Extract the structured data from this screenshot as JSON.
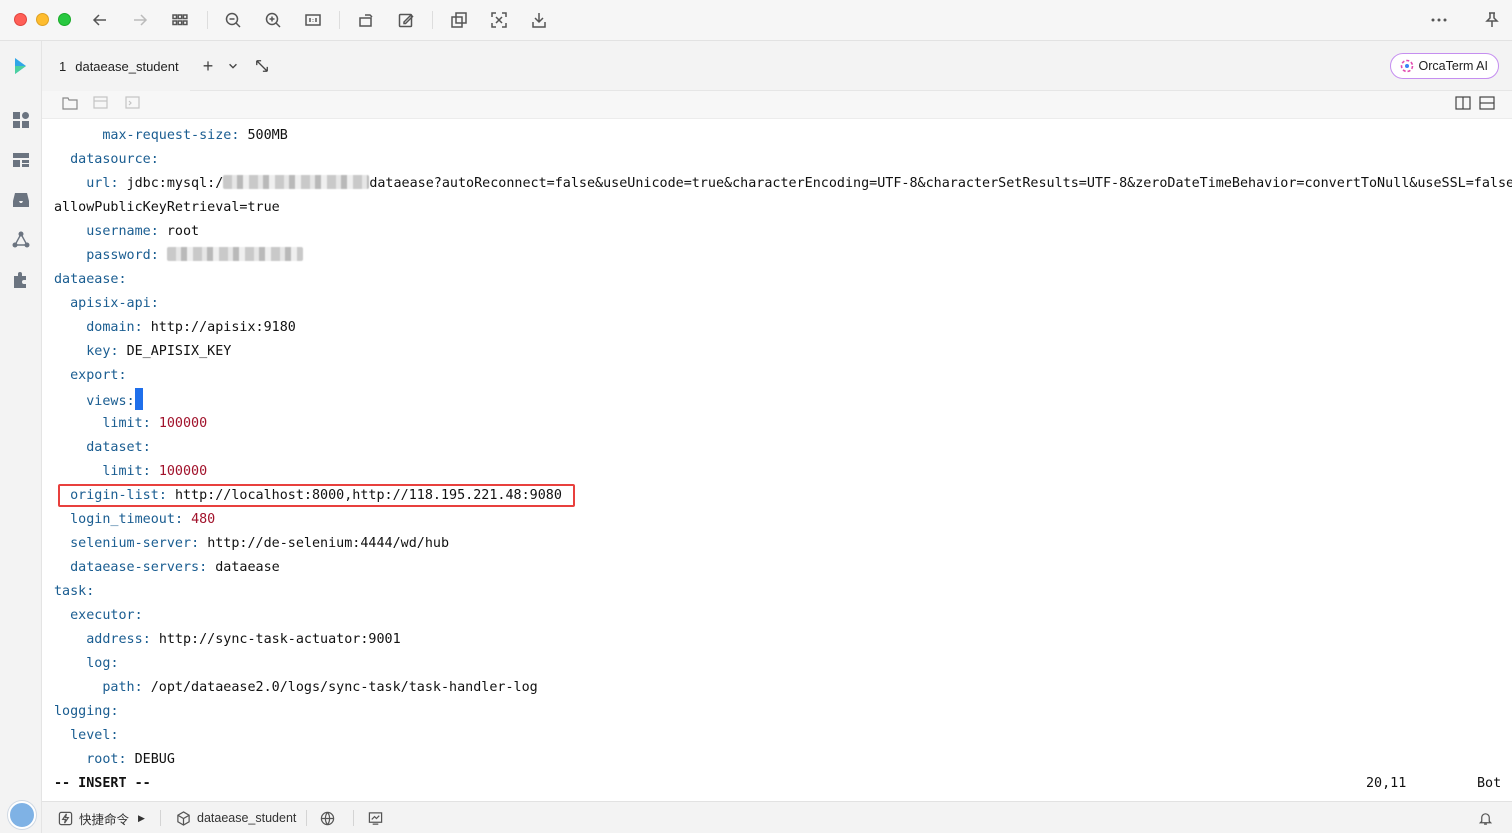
{
  "tabs": [
    {
      "number": "1",
      "label": "dataease_student"
    }
  ],
  "orca_button": {
    "label": "OrcaTerm AI"
  },
  "terminal": {
    "lines": [
      {
        "indent": "      ",
        "key": "max-request-size",
        "value": "500MB",
        "type": "str"
      },
      {
        "indent": "  ",
        "key": "datasource",
        "value": "",
        "type": "str"
      },
      {
        "indent": "    ",
        "key": "url",
        "value_prefix": "jdbc:mysql:/",
        "value_suffix": "dataease?autoReconnect=false&useUnicode=true&characterEncoding=UTF-8&characterSetResults=UTF-8&zeroDateTimeBehavior=convertToNull&useSSL=false&"
      },
      {
        "text": "allowPublicKeyRetrieval=true"
      },
      {
        "indent": "    ",
        "key": "username",
        "value": "root",
        "type": "str"
      },
      {
        "indent": "    ",
        "key": "password",
        "value": "",
        "type": "blur"
      },
      {
        "indent": "",
        "key": "dataease",
        "value": "",
        "type": "str"
      },
      {
        "indent": "  ",
        "key": "apisix-api",
        "value": "",
        "type": "str"
      },
      {
        "indent": "    ",
        "key": "domain",
        "value": "http://apisix:9180",
        "type": "str"
      },
      {
        "indent": "    ",
        "key": "key",
        "value": "DE_APISIX_KEY",
        "type": "str"
      },
      {
        "indent": "  ",
        "key": "export",
        "value": "",
        "type": "str"
      },
      {
        "indent": "    ",
        "key": "views",
        "value": "",
        "type": "cursor"
      },
      {
        "indent": "      ",
        "key": "limit",
        "value": "100000",
        "type": "num"
      },
      {
        "indent": "    ",
        "key": "dataset",
        "value": "",
        "type": "str"
      },
      {
        "indent": "      ",
        "key": "limit",
        "value": "100000",
        "type": "num"
      },
      {
        "indent": "  ",
        "key": "origin-list",
        "value": "http://localhost:8000,http://118.195.221.48:9080",
        "type": "str"
      },
      {
        "indent": "  ",
        "key": "login_timeout",
        "value": "480",
        "type": "num"
      },
      {
        "indent": "  ",
        "key": "selenium-server",
        "value": "http://de-selenium:4444/wd/hub",
        "type": "str"
      },
      {
        "indent": "  ",
        "key": "dataease-servers",
        "value": "dataease",
        "type": "str"
      },
      {
        "indent": "",
        "key": "task",
        "value": "",
        "type": "str"
      },
      {
        "indent": "  ",
        "key": "executor",
        "value": "",
        "type": "str"
      },
      {
        "indent": "    ",
        "key": "address",
        "value": "http://sync-task-actuator:9001",
        "type": "str"
      },
      {
        "indent": "    ",
        "key": "log",
        "value": "",
        "type": "str"
      },
      {
        "indent": "      ",
        "key": "path",
        "value": "/opt/dataease2.0/logs/sync-task/task-handler-log",
        "type": "str"
      },
      {
        "indent": "",
        "key": "logging",
        "value": "",
        "type": "str"
      },
      {
        "indent": "  ",
        "key": "level",
        "value": "",
        "type": "str"
      },
      {
        "indent": "    ",
        "key": "root",
        "value": "DEBUG",
        "type": "str"
      }
    ],
    "status": {
      "mode": "-- INSERT --",
      "position": "20,11",
      "scroll": "Bot"
    }
  },
  "bottombar": {
    "quick_command": "快捷命令",
    "session": "dataease_student"
  },
  "colors": {
    "key": "#1a5d91",
    "number": "#a1122b",
    "highlight": "#e8403d",
    "cursor": "#1f6feb"
  }
}
